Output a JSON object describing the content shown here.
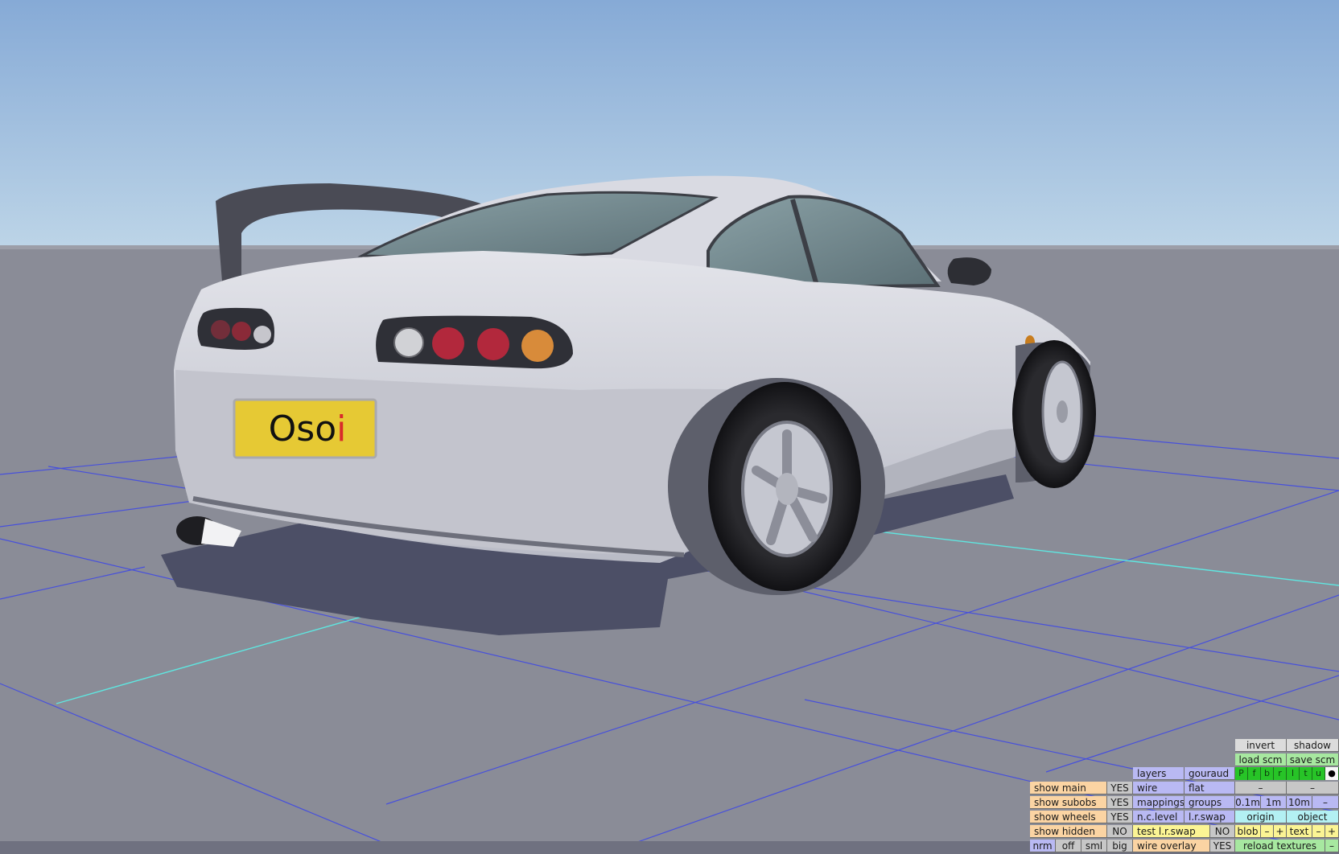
{
  "scene": {
    "plate_text_dark": "Oso",
    "plate_text_red": "i",
    "colors": {
      "sky_top": "#8bb0d8",
      "sky_bottom": "#b9d2e6",
      "ground": "#8a8c97",
      "grid_line": "#3c46e8",
      "grid_axis": "#5fe6e0",
      "car_body": "#d7d8e0",
      "plate_bg": "#e6c934",
      "plate_red": "#d92a2a"
    }
  },
  "panel": {
    "invert": "invert",
    "shadow": "shadow",
    "load_scm": "load scm",
    "save_scm": "save scm",
    "layers": "layers",
    "gouraud": "gouraud",
    "p_letters": [
      "P",
      "f",
      "b",
      "r",
      "l",
      "t",
      "u"
    ],
    "dot": "●",
    "show_main": "show main",
    "show_main_val": "YES",
    "wire": "wire",
    "flat": "flat",
    "dash1": "–",
    "dash2": "–",
    "show_subobs": "show subobs",
    "show_subobs_val": "YES",
    "mappings": "mappings",
    "groups": "groups",
    "grid_01": "0.1m",
    "grid_1": "1m",
    "grid_10": "10m",
    "grid_dash": "–",
    "show_wheels": "show wheels",
    "show_wheels_val": "YES",
    "nc_level": "n.c.level",
    "lr_swap": "l.r.swap",
    "origin": "origin",
    "object": "object",
    "show_hidden": "show hidden",
    "show_hidden_val": "NO",
    "test_lr_swap": "test l.r.swap",
    "test_lr_swap_val": "NO",
    "blob": "blob",
    "blob_minus": "–",
    "blob_plus": "+",
    "text": "text",
    "text_minus": "–",
    "text_plus": "+",
    "nrm": "nrm",
    "off": "off",
    "sml": "sml",
    "big": "big",
    "wire_overlay": "wire overlay",
    "wire_overlay_val": "YES",
    "reload_textures": "reload textures",
    "reload_minus": "–"
  }
}
